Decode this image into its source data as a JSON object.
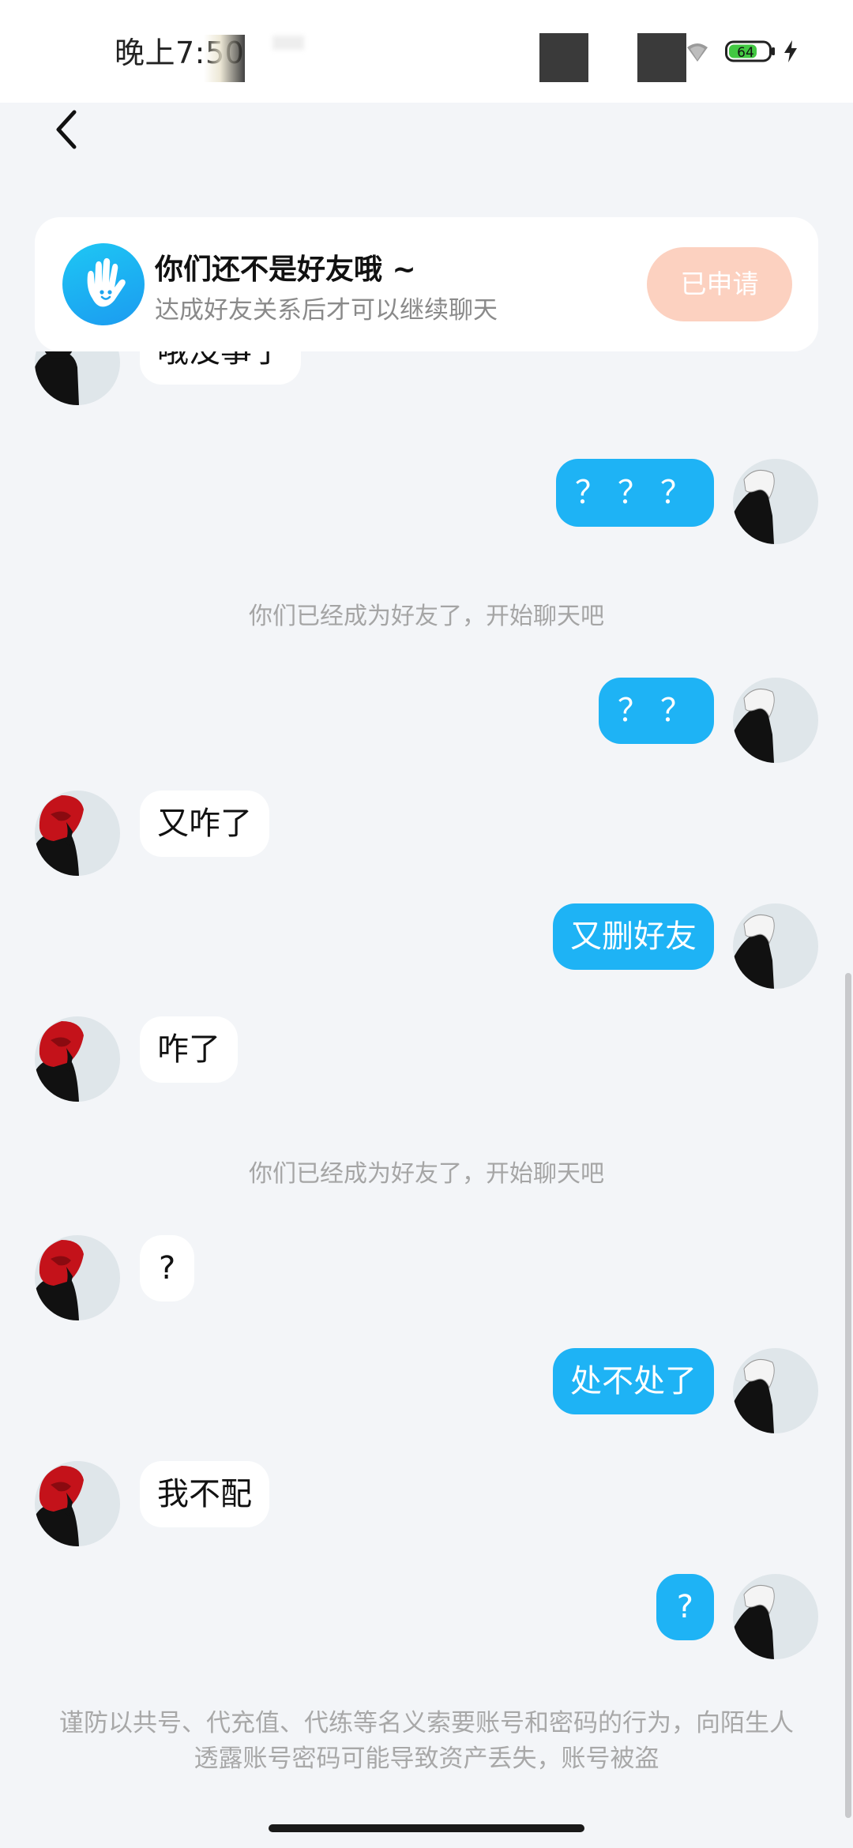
{
  "status_bar": {
    "time": "晚上7:50",
    "battery_level": "64",
    "icons": [
      "wifi-icon",
      "battery-icon",
      "charging-icon"
    ]
  },
  "nav": {
    "back_icon": "chevron-left-icon"
  },
  "friend_notice": {
    "title": "你们还不是好友哦 ~",
    "subtitle": "达成好友关系后才可以继续聊天",
    "button_label": "已申请",
    "icon": "hand-icon"
  },
  "chat": {
    "partial_message": "哦没事了",
    "messages": [
      {
        "side": "right",
        "text": "？？？"
      },
      {
        "side": "system",
        "text": "你们已经成为好友了，开始聊天吧"
      },
      {
        "side": "right",
        "text": "？？"
      },
      {
        "side": "left",
        "text": "又咋了"
      },
      {
        "side": "right",
        "text": "又删好友"
      },
      {
        "side": "left",
        "text": "咋了"
      },
      {
        "side": "system",
        "text": "你们已经成为好友了，开始聊天吧"
      },
      {
        "side": "left",
        "text": "?"
      },
      {
        "side": "right",
        "text": "处不处了"
      },
      {
        "side": "left",
        "text": "我不配"
      },
      {
        "side": "right",
        "text": "?"
      }
    ]
  },
  "footer": {
    "warning": "谨防以共号、代充值、代练等名义索要账号和密码的行为，向陌生人透露账号密码可能导致资产丢失，账号被盗"
  },
  "colors": {
    "accent": "#1eb3f5",
    "applied_button": "#fcd1c0",
    "background": "#f3f5f8"
  }
}
